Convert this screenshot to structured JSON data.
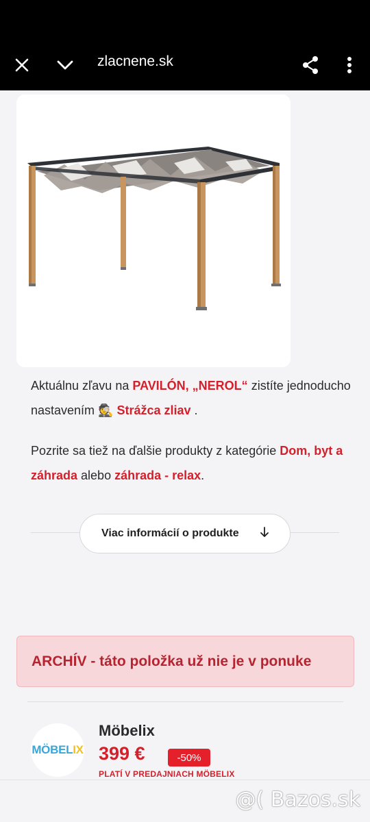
{
  "browser": {
    "url": "zlacnene.sk",
    "close_icon": "close-icon",
    "collapse_icon": "chevron-down-icon",
    "share_icon": "share-icon",
    "menu_icon": "more-vert-icon"
  },
  "product": {
    "image_alt": "pavilion-image"
  },
  "description": {
    "p1_part1": "Aktuálnu zľavu na ",
    "p1_product": "PAVILÓN, „NEROL“",
    "p1_part2": " zistíte jednoducho nastavením ",
    "p1_guard": "🕵 Strážca zliav",
    "p1_end": " .",
    "p2_part1": "Pozrite sa tiež na ďalšie produkty z kategórie ",
    "p2_cat1": "Dom, byt a záhrada",
    "p2_part2": " alebo ",
    "p2_cat2": "záhrada - relax",
    "p2_end": "."
  },
  "more_button": {
    "label": "Viac informácií o produkte",
    "icon": "arrow-down-icon"
  },
  "archive_notice": "ARCHÍV - táto položka už nie je v ponuke",
  "shop": {
    "logo_text": "MÖBELIX",
    "name": "Möbelix",
    "price": "399 €",
    "discount": "-50%",
    "note": "PLATÍ V PREDAJNIACH MÖBELIX"
  },
  "watermark": "@( Bazos.sk",
  "colors": {
    "accent_red": "#d4202b",
    "archive_bg": "#f8d7da"
  }
}
